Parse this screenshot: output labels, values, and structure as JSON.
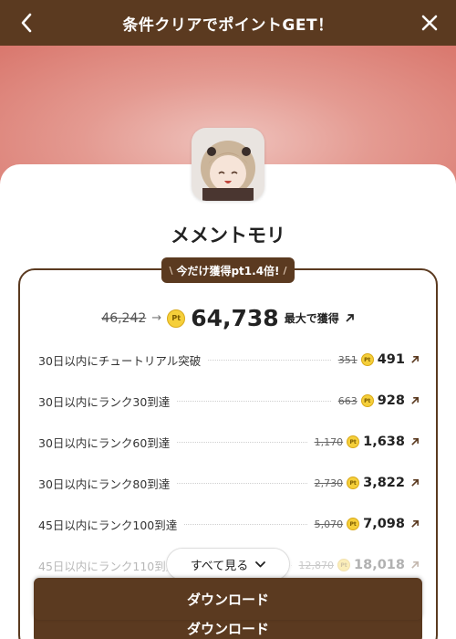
{
  "header": {
    "title": "条件クリアでポイントGET！"
  },
  "app": {
    "name": "メメントモリ"
  },
  "badge": {
    "text": "今だけ獲得pt1.4倍!"
  },
  "total": {
    "old": "46,242",
    "new": "64,738",
    "suffix": "最大で獲得",
    "coin": "Pt"
  },
  "tasks": [
    {
      "label": "30日以内にチュートリアル突破",
      "old": "351",
      "new": "491"
    },
    {
      "label": "30日以内にランク30到達",
      "old": "663",
      "new": "928"
    },
    {
      "label": "30日以内にランク60到達",
      "old": "1,170",
      "new": "1,638"
    },
    {
      "label": "30日以内にランク80到達",
      "old": "2,730",
      "new": "3,822"
    },
    {
      "label": "45日以内にランク100到達",
      "old": "5,070",
      "new": "7,098"
    },
    {
      "label": "45日以内にランク110到達",
      "old": "12,870",
      "new": "18,018"
    }
  ],
  "see_all": {
    "label": "すべて見る"
  },
  "download": {
    "label": "ダウンロード",
    "label_back": "ダウンロード"
  },
  "colors": {
    "brand_brown": "#5b3a20",
    "hero_pink": "#e49a91",
    "coin_yellow": "#f5cf3a"
  },
  "icons": {
    "back": "chevron-left-icon",
    "close": "close-icon",
    "external": "arrow-up-right-icon",
    "expand": "chevron-down-icon",
    "coin": "point-coin-icon"
  }
}
